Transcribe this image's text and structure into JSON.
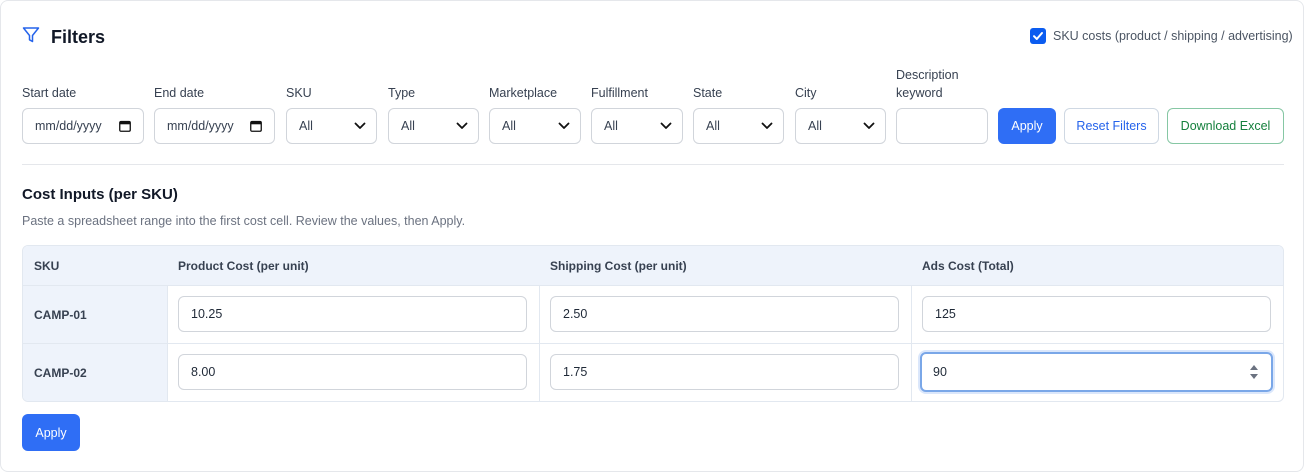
{
  "header": {
    "title": "Filters",
    "sku_costs_checkbox_label": "SKU costs (product / shipping / advertising)",
    "sku_costs_checked": true
  },
  "filters": {
    "start_date": {
      "label": "Start date",
      "value": "mm/dd/yyyy"
    },
    "end_date": {
      "label": "End date",
      "value": "mm/dd/yyyy"
    },
    "sku": {
      "label": "SKU",
      "value": "All"
    },
    "type": {
      "label": "Type",
      "value": "All"
    },
    "marketplace": {
      "label": "Marketplace",
      "value": "All"
    },
    "fulfillment": {
      "label": "Fulfillment",
      "value": "All"
    },
    "state": {
      "label": "State",
      "value": "All"
    },
    "city": {
      "label": "City",
      "value": "All"
    },
    "description_keyword": {
      "label_line1": "Description",
      "label_line2": "keyword",
      "value": ""
    },
    "apply_label": "Apply",
    "reset_label": "Reset Filters",
    "download_label": "Download Excel"
  },
  "cost_inputs": {
    "title": "Cost Inputs (per SKU)",
    "description": "Paste a spreadsheet range into the first cost cell. Review the values, then Apply.",
    "columns": [
      "SKU",
      "Product Cost (per unit)",
      "Shipping Cost (per unit)",
      "Ads Cost (Total)"
    ],
    "rows": [
      {
        "sku": "CAMP-01",
        "product_cost": "10.25",
        "shipping_cost": "2.50",
        "ads_cost": "125"
      },
      {
        "sku": "CAMP-02",
        "product_cost": "8.00",
        "shipping_cost": "1.75",
        "ads_cost": "90"
      }
    ],
    "apply_label": "Apply"
  },
  "colors": {
    "primary": "#2f6ef5",
    "reset_text": "#2563eb",
    "download_text": "#15803d",
    "table_header_bg": "#eef3fb"
  },
  "icons": {
    "filters": "funnel-icon",
    "date": "calendar-icon",
    "select": "chevron-down-icon",
    "number": "spinner-arrows-icon"
  }
}
